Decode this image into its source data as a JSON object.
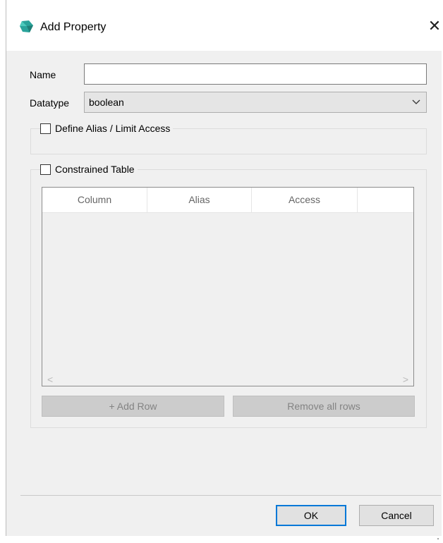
{
  "window": {
    "title": "Add Property",
    "close_symbol": "✕"
  },
  "form": {
    "name_label": "Name",
    "name_value": "",
    "datatype_label": "Datatype",
    "datatype_value": "boolean"
  },
  "alias_group": {
    "label": "Define Alias / Limit Access",
    "checked": false
  },
  "constrained_group": {
    "label": "Constrained Table",
    "checked": false
  },
  "table": {
    "columns": [
      "Column",
      "Alias",
      "Access"
    ],
    "scroll_left": "<",
    "scroll_right": ">"
  },
  "buttons": {
    "add_row": "+ Add Row",
    "remove_all": "Remove all rows",
    "ok": "OK",
    "cancel": "Cancel"
  },
  "colors": {
    "accent": "#0078d7",
    "app_icon": "#2aa39a"
  }
}
